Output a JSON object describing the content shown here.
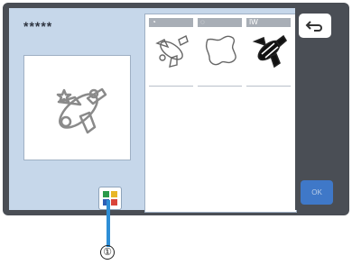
{
  "pattern_name": "*****",
  "tabs": [
    {
      "icon": "rotate-icon",
      "label": ""
    },
    {
      "icon": "outline-icon",
      "label": ""
    },
    {
      "icon": "fill-icon",
      "label": "IW"
    }
  ],
  "buttons": {
    "back_icon": "return-arrow-icon",
    "ok_label": "OK",
    "color_icon": "color-palette-icon"
  },
  "callout": {
    "number": "①"
  },
  "colors": {
    "panel_bg": "#c6d7ea",
    "frame": "#4a4e55",
    "ok_button": "#3f78c8",
    "callout_line": "#2e8ed6"
  }
}
